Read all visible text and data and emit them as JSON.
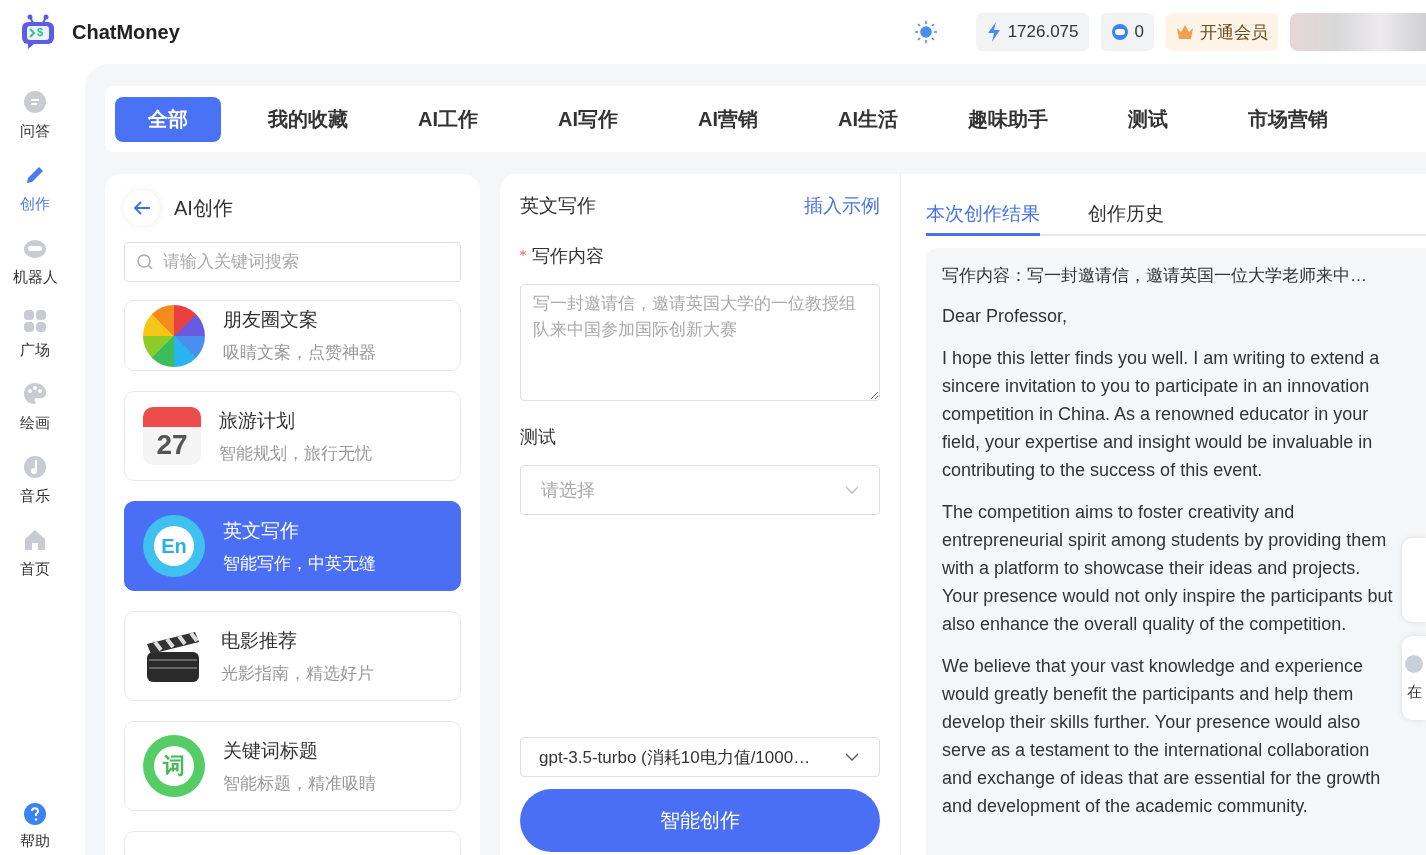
{
  "header": {
    "logo_mark": "$",
    "brand": "ChatMoney",
    "power": "1726.075",
    "chats": "0",
    "vip": "开通会员"
  },
  "nav": [
    {
      "label": "问答",
      "kind": "chat",
      "selected": false
    },
    {
      "label": "创作",
      "kind": "pen",
      "selected": true
    },
    {
      "label": "机器人",
      "kind": "robot",
      "selected": false
    },
    {
      "label": "广场",
      "kind": "grid",
      "selected": false
    },
    {
      "label": "绘画",
      "kind": "palette",
      "selected": false
    },
    {
      "label": "音乐",
      "kind": "music",
      "selected": false
    },
    {
      "label": "首页",
      "kind": "home",
      "selected": false
    }
  ],
  "help": "帮助",
  "category_tabs": [
    {
      "label": "全部",
      "selected": true
    },
    {
      "label": "我的收藏",
      "selected": false
    },
    {
      "label": "AI工作",
      "selected": false
    },
    {
      "label": "AI写作",
      "selected": false
    },
    {
      "label": "AI营销",
      "selected": false
    },
    {
      "label": "AI生活",
      "selected": false
    },
    {
      "label": "趣味助手",
      "selected": false
    },
    {
      "label": "测试",
      "selected": false
    },
    {
      "label": "市场营销",
      "selected": false
    }
  ],
  "app_panel": {
    "title": "AI创作",
    "search": {
      "placeholder": "请输入关键词搜索"
    },
    "apps": [
      {
        "name": "朋友圈文案",
        "desc": "吸睛文案，点赞神器",
        "kind": "aperture",
        "selected": false
      },
      {
        "name": "旅游计划",
        "desc": "智能规划，旅行无忧",
        "kind": "calendar",
        "icon_text": "27",
        "selected": false
      },
      {
        "name": "英文写作",
        "desc": "智能写作，中英无缝",
        "kind": "letters",
        "icon_text": "En",
        "selected": true
      },
      {
        "name": "电影推荐",
        "desc": "光影指南，精选好片",
        "kind": "clapper",
        "selected": false
      },
      {
        "name": "关键词标题",
        "desc": "智能标题，精准吸睛",
        "kind": "word",
        "icon_text": "词",
        "selected": false
      }
    ]
  },
  "form": {
    "title": "英文写作",
    "insert_link": "插入示例",
    "fields": [
      {
        "label": "写作内容",
        "required": true,
        "kind": "textarea",
        "placeholder": "写一封邀请信，邀请英国大学的一位教授组队来中国参加国际创新大赛"
      },
      {
        "label": "测试",
        "required": false,
        "kind": "select",
        "placeholder": "请选择"
      }
    ],
    "model": "gpt-3.5-turbo (消耗10电力值/1000…",
    "submit": "智能创作"
  },
  "results": {
    "tabs": [
      {
        "label": "本次创作结果",
        "selected": true
      },
      {
        "label": "创作历史",
        "selected": false
      }
    ],
    "prompt": "写作内容：写一封邀请信，邀请英国一位大学老师来中…",
    "paragraphs": [
      "Dear Professor,",
      "I hope this letter finds you well. I am writing to extend a sincere invitation to you to participate in an innovation competition in China. As a renowned educator in your field, your expertise and insight would be invaluable in contributing to the success of this event.",
      "The competition aims to foster creativity and entrepreneurial spirit among students by providing them with a platform to showcase their ideas and projects. Your presence would not only inspire the participants but also enhance the overall quality of the competition.",
      "We believe that your vast knowledge and experience would greatly benefit the participants and help them develop their skills further. Your presence would also serve as a testament to the international collaboration and exchange of ideas that are essential for the growth and development of the academic community."
    ]
  },
  "floating": [
    {
      "label": "在"
    }
  ]
}
